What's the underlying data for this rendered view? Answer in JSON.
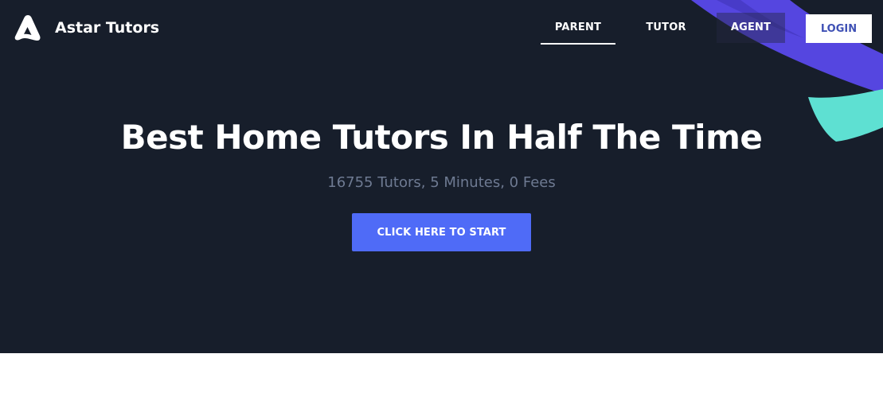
{
  "header": {
    "brand_name": "Astar Tutors",
    "logo_icon": "astar-logo-icon",
    "nav": [
      {
        "label": "PARENT",
        "active": true
      },
      {
        "label": "TUTOR",
        "active": false
      },
      {
        "label": "AGENT",
        "active": false
      }
    ],
    "login_label": "LOGIN"
  },
  "hero": {
    "headline": "Best Home Tutors In Half The Time",
    "subline": "16755 Tutors, 5 Minutes, 0 Fees",
    "cta_label": "CLICK HERE TO START"
  },
  "colors": {
    "hero_background": "#171e2b",
    "accent_purple": "#5546e0",
    "accent_teal": "#5ee0d2",
    "cta_blue": "#4f6bf7",
    "login_text": "#3f51b5",
    "subline_gray": "#6e7a92"
  }
}
